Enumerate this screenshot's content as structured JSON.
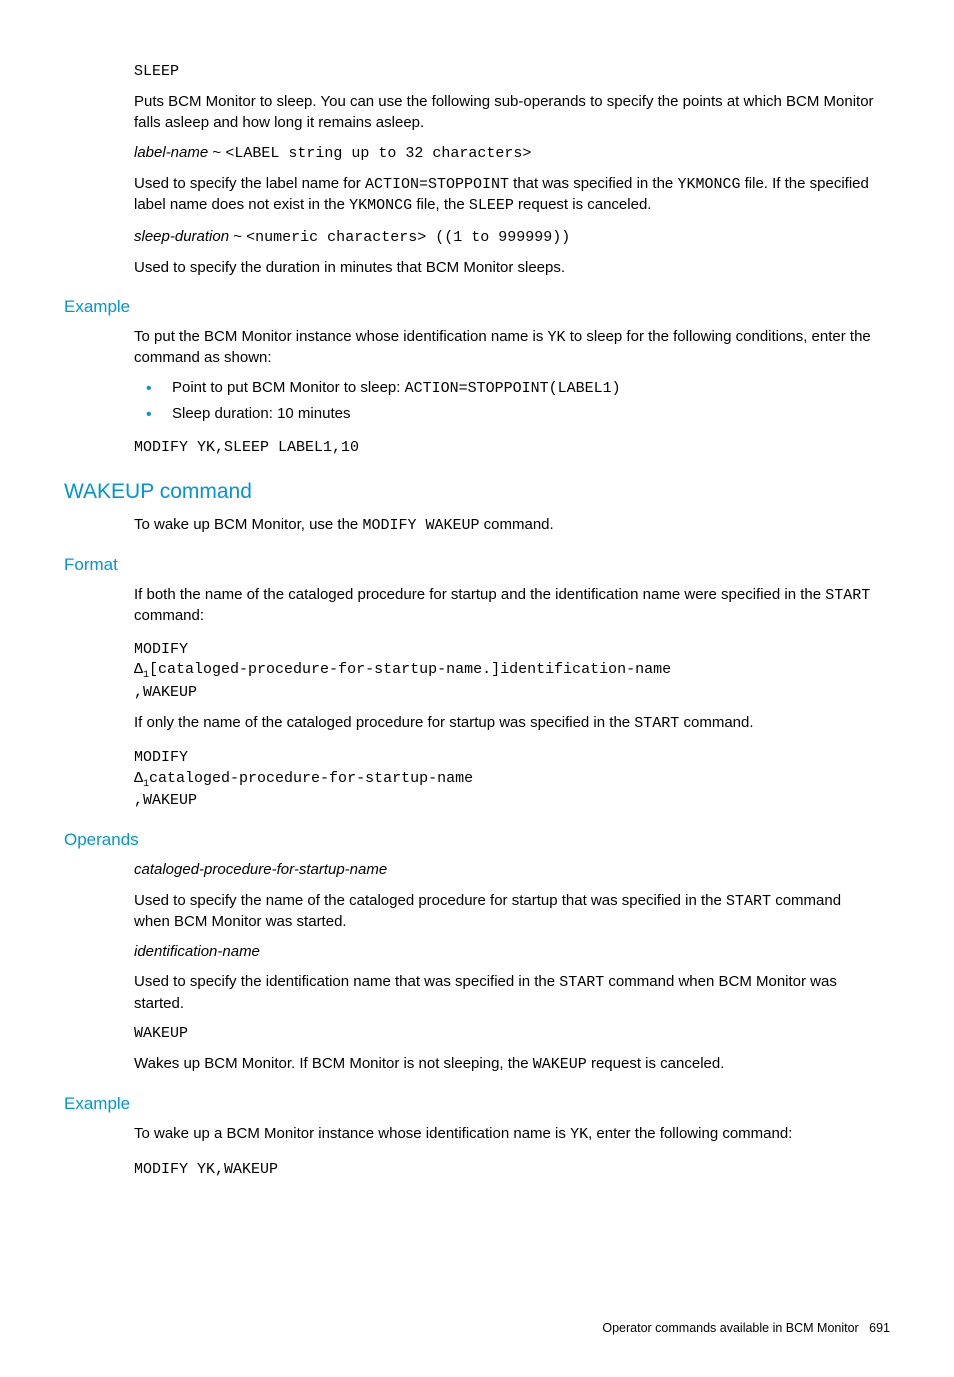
{
  "sleep": {
    "kw": "SLEEP",
    "desc": "Puts BCM Monitor to sleep. You can use the following sub-operands to specify the points at which BCM Monitor falls asleep and how long it remains asleep.",
    "label_name_term": "label-name",
    "label_name_tilde": " ~ ",
    "label_name_val": "<LABEL string up to 32 characters>",
    "label_desc_pre": "Used to specify the label name for ",
    "label_desc_c1": "ACTION=STOPPOINT",
    "label_desc_mid": " that was specified in the ",
    "label_desc_c2": "YKMONCG",
    "label_desc_mid2": " file. If the specified label name does not exist in the ",
    "label_desc_c3": "YKMONCG",
    "label_desc_mid3": " file, the ",
    "label_desc_c4": "SLEEP",
    "label_desc_end": " request is canceled.",
    "dur_term": "sleep-duration",
    "dur_tilde": " ~ ",
    "dur_val": "<numeric characters> ((1 to 999999))",
    "dur_desc": "Used to specify the duration in minutes that BCM Monitor sleeps."
  },
  "example1": {
    "heading": "Example",
    "intro_pre": "To put the BCM Monitor instance whose identification name is ",
    "intro_c1": "YK",
    "intro_post": " to sleep for the following conditions, enter the command as shown:",
    "b1_pre": "Point to put BCM Monitor to sleep: ",
    "b1_c": "ACTION=STOPPOINT(LABEL1)",
    "b2": "Sleep duration: 10 minutes",
    "code": "MODIFY YK,SLEEP LABEL1,10"
  },
  "wakeup": {
    "heading": "WAKEUP command",
    "intro_pre": "To wake up BCM Monitor, use the ",
    "intro_c": "MODIFY WAKEUP",
    "intro_post": " command."
  },
  "format": {
    "heading": "Format",
    "p1_pre": "If both the name of the cataloged procedure for startup and the identification name were specified in the ",
    "p1_c": "START",
    "p1_post": " command:",
    "code1_l1": "MODIFY",
    "code1_l2a": "Δ",
    "code1_l2b": "[cataloged-procedure-for-startup-name.]identification-name",
    "code1_l3": ",WAKEUP",
    "p2_pre": "If only the name of the cataloged procedure for startup was specified in the ",
    "p2_c": "START",
    "p2_post": " command.",
    "code2_l1": "MODIFY",
    "code2_l2a": "Δ",
    "code2_l2b": "cataloged-procedure-for-startup-name",
    "code2_l3": ",WAKEUP",
    "sub1": "1"
  },
  "operands": {
    "heading": "Operands",
    "t1": "cataloged-procedure-for-startup-name",
    "d1_pre": "Used to specify the name of the cataloged procedure for startup that was specified in the ",
    "d1_c": "START",
    "d1_post": " command when BCM Monitor was started.",
    "t2": "identification-name",
    "d2_pre": "Used to specify the identification name that was specified in the ",
    "d2_c": "START",
    "d2_post": " command when BCM Monitor was started.",
    "t3": "WAKEUP",
    "d3_pre": "Wakes up BCM Monitor. If BCM Monitor is not sleeping, the ",
    "d3_c": "WAKEUP",
    "d3_post": " request is canceled."
  },
  "example2": {
    "heading": "Example",
    "p_pre": "To wake up a BCM Monitor instance whose identification name is ",
    "p_c": "YK",
    "p_post": ", enter the following command:",
    "code": "MODIFY YK,WAKEUP"
  },
  "footer": {
    "text": "Operator commands available in BCM Monitor",
    "page": "691"
  }
}
